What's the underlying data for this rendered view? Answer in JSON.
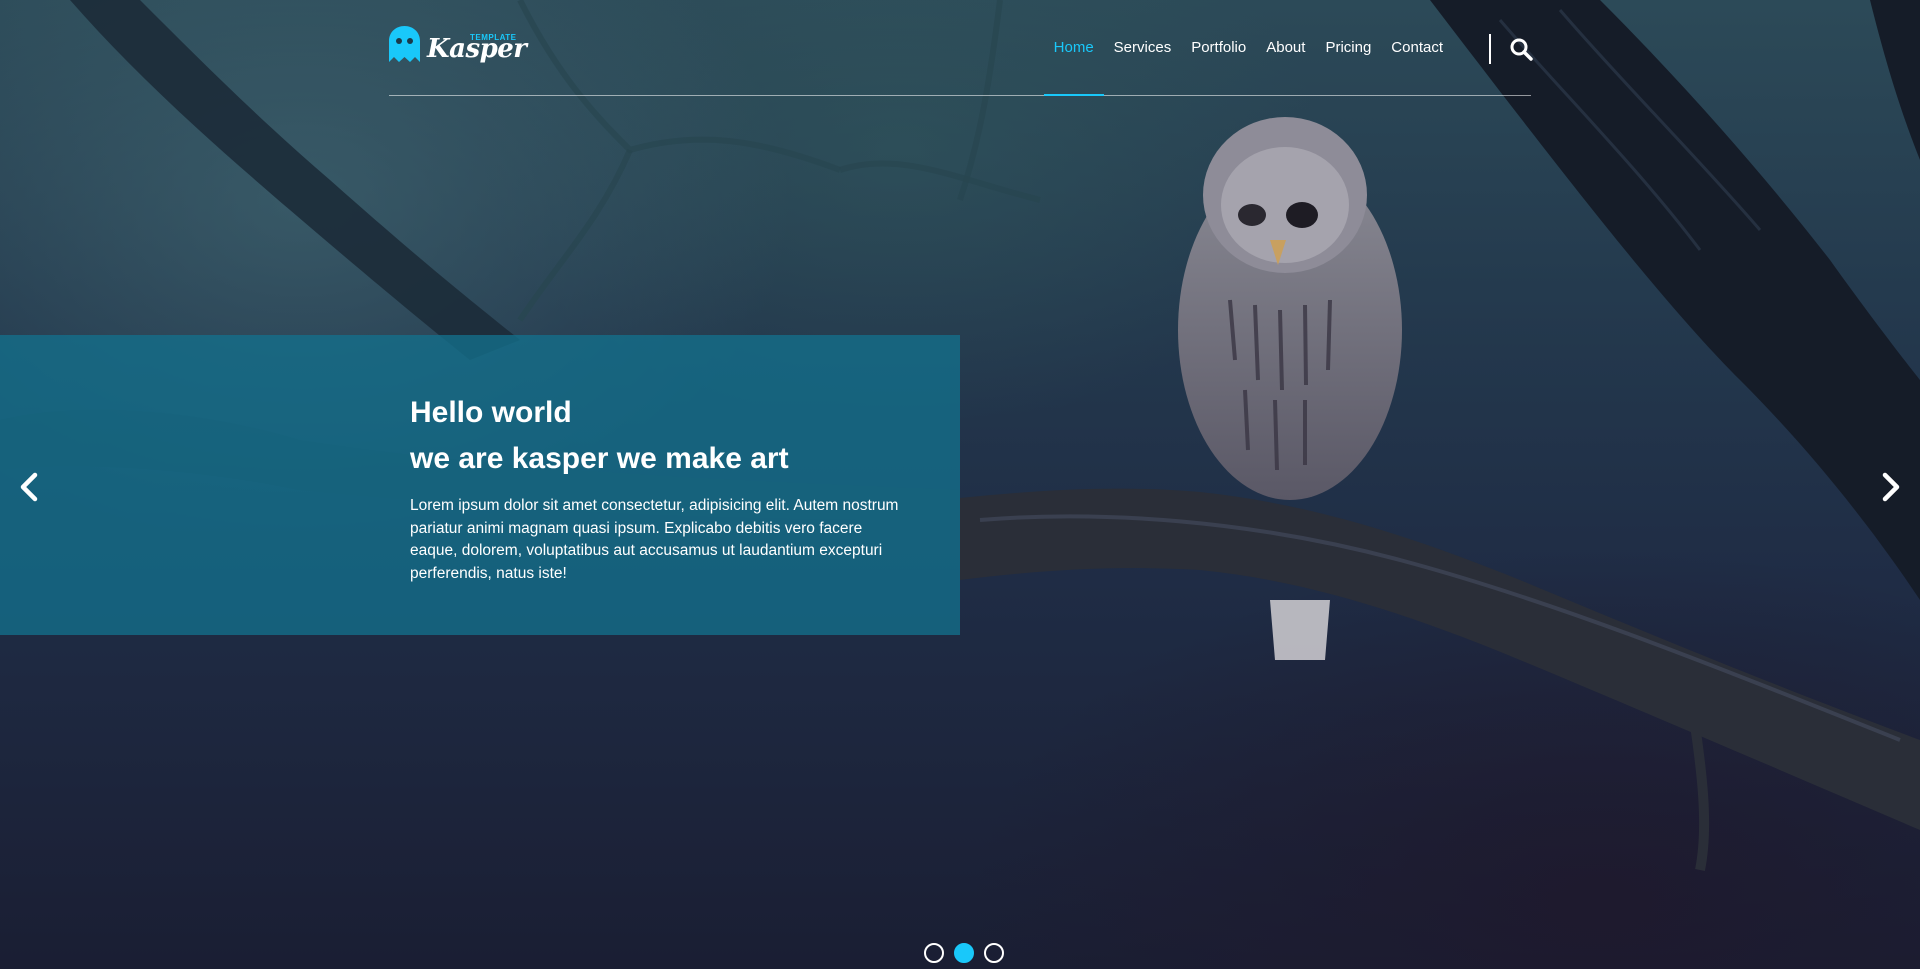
{
  "brand": {
    "name": "Kasper",
    "tagline": "TEMPLATE",
    "accent_color": "#19c8fa",
    "icon": "ghost-icon"
  },
  "nav": {
    "items": [
      {
        "label": "Home",
        "active": true
      },
      {
        "label": "Services",
        "active": false
      },
      {
        "label": "Portfolio",
        "active": false
      },
      {
        "label": "About",
        "active": false
      },
      {
        "label": "Pricing",
        "active": false
      },
      {
        "label": "Contact",
        "active": false
      }
    ],
    "search_icon": "search-icon"
  },
  "slide": {
    "title_line1": "Hello world",
    "title_line2": "we are kasper we make art",
    "body": "Lorem ipsum dolor sit amet consectetur, adipisicing elit. Autem nostrum pariatur animi magnam quasi ipsum. Explicabo debitis vero facere eaque, dolorem, voluptatibus aut accusamus ut laudantium excepturi perferendis, natus iste!",
    "panel_color": "#13708c"
  },
  "controls": {
    "prev_icon": "chevron-left-icon",
    "next_icon": "chevron-right-icon",
    "bullets": [
      {
        "active": false
      },
      {
        "active": true
      },
      {
        "active": false
      }
    ]
  }
}
